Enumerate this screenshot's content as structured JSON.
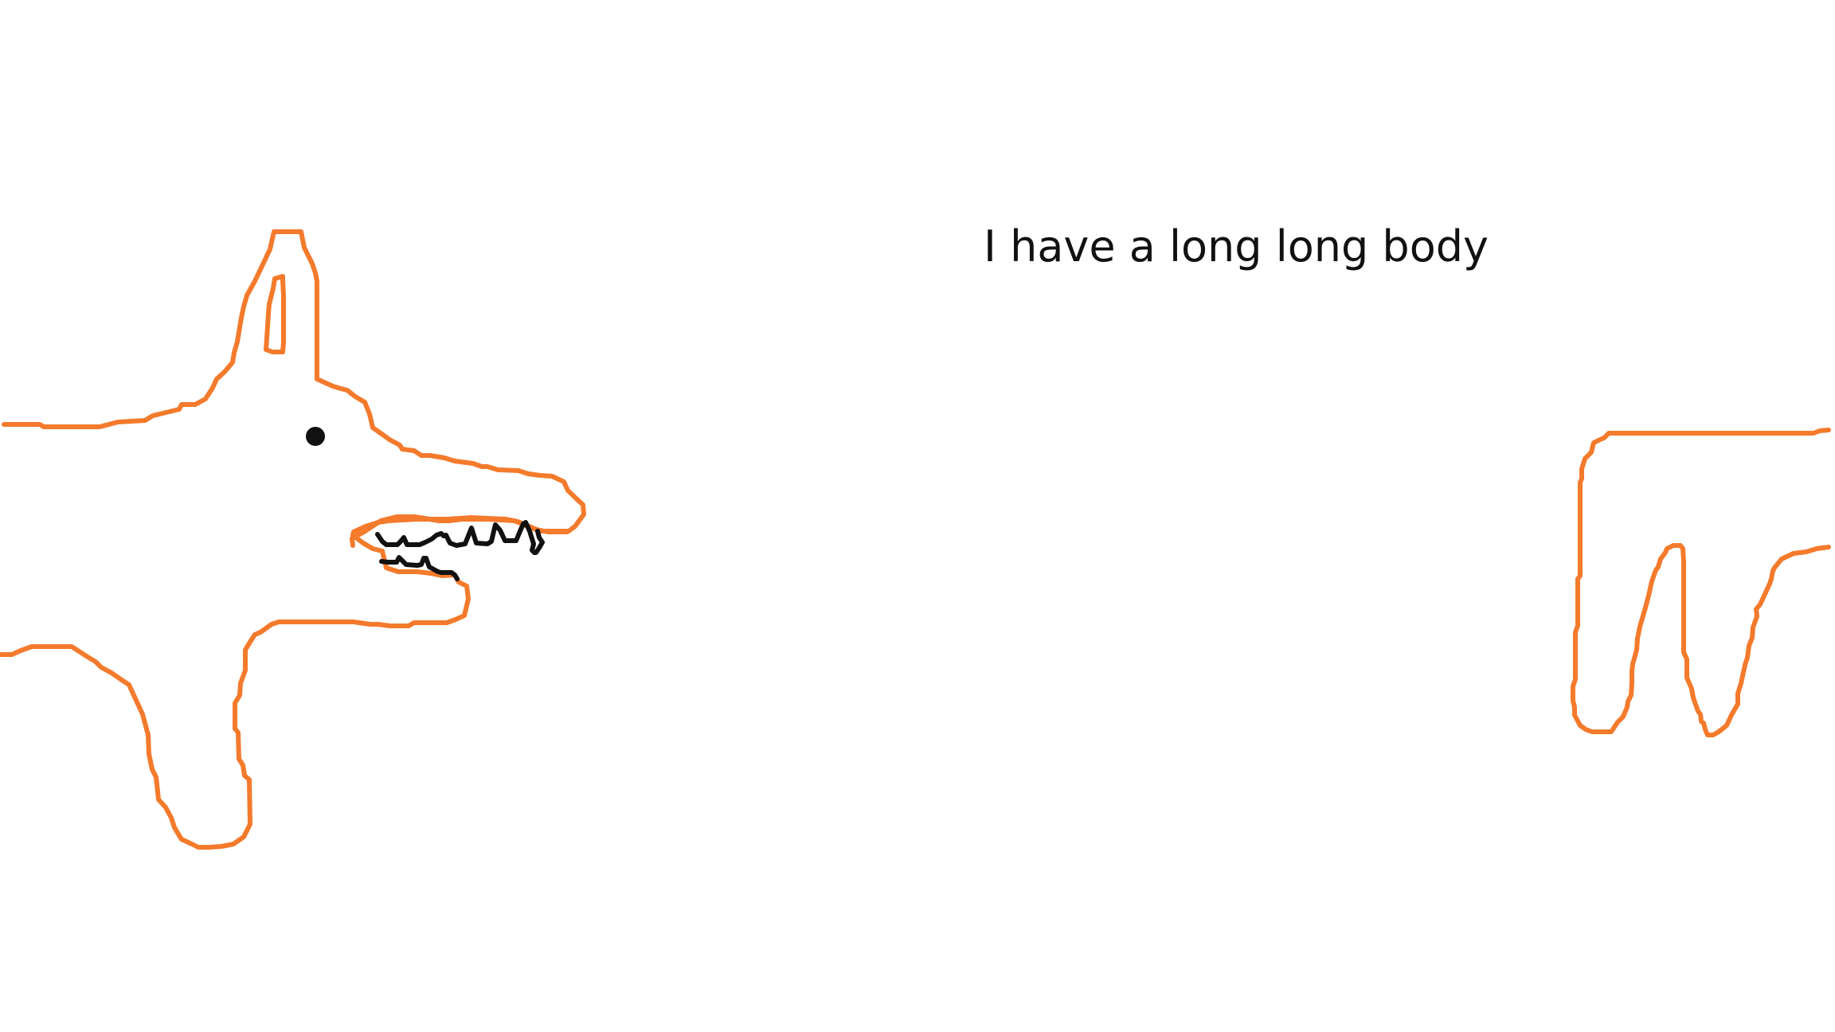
{
  "caption": "I have a long long body",
  "colors": {
    "background": "#ffffff",
    "outline": "#f47a2c",
    "ink": "#111111"
  }
}
